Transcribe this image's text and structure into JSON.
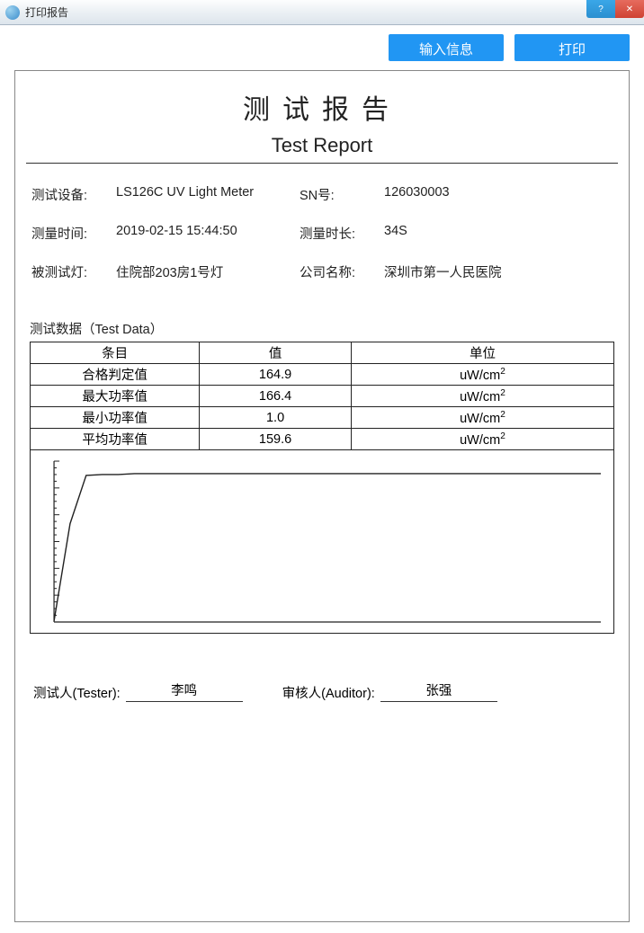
{
  "window": {
    "title": "打印报告",
    "help_label": "?",
    "close_label": "✕"
  },
  "toolbar": {
    "input_info_label": "输入信息",
    "print_label": "打印"
  },
  "report": {
    "title_cn": "测试报告",
    "title_en": "Test Report",
    "meta": {
      "device_label": "测试设备:",
      "device_value": "LS126C UV Light Meter",
      "sn_label": "SN号:",
      "sn_value": "126030003",
      "time_label": "测量时间:",
      "time_value": "2019-02-15 15:44:50",
      "duration_label": "测量时长:",
      "duration_value": "34S",
      "lamp_label": "被测试灯:",
      "lamp_value": "住院部203房1号灯",
      "company_label": "公司名称:",
      "company_value": "深圳市第一人民医院"
    },
    "data_heading": "测试数据（Test Data）",
    "table": {
      "headers": [
        "条目",
        "值",
        "单位"
      ],
      "rows": [
        [
          "合格判定值",
          "164.9",
          "uW/cm²"
        ],
        [
          "最大功率值",
          "166.4",
          "uW/cm²"
        ],
        [
          "最小功率值",
          "1.0",
          "uW/cm²"
        ],
        [
          "平均功率值",
          "159.6",
          "uW/cm²"
        ]
      ]
    },
    "signatures": {
      "tester_label": "测试人(Tester):",
      "tester_value": "李鸣",
      "auditor_label": "审核人(Auditor):",
      "auditor_value": "张强"
    }
  },
  "chart_data": {
    "type": "line",
    "x": [
      0,
      1,
      2,
      3,
      4,
      5,
      6,
      7,
      8,
      9,
      10,
      11,
      12,
      13,
      14,
      15,
      16,
      17,
      18,
      19,
      20,
      21,
      22,
      23,
      24,
      25,
      26,
      27,
      28,
      29,
      30,
      31,
      32,
      33,
      34
    ],
    "values": [
      1,
      110,
      164,
      165,
      165,
      166,
      166,
      166,
      166,
      166,
      166,
      166,
      166,
      166,
      166,
      166,
      166,
      166,
      166,
      166,
      166,
      166,
      166,
      166,
      166,
      166,
      166,
      166,
      166,
      166,
      166,
      166,
      166,
      166,
      166
    ],
    "ylim": [
      0,
      180
    ],
    "xlim": [
      0,
      34
    ],
    "xlabel": "",
    "ylabel": "",
    "title": ""
  }
}
